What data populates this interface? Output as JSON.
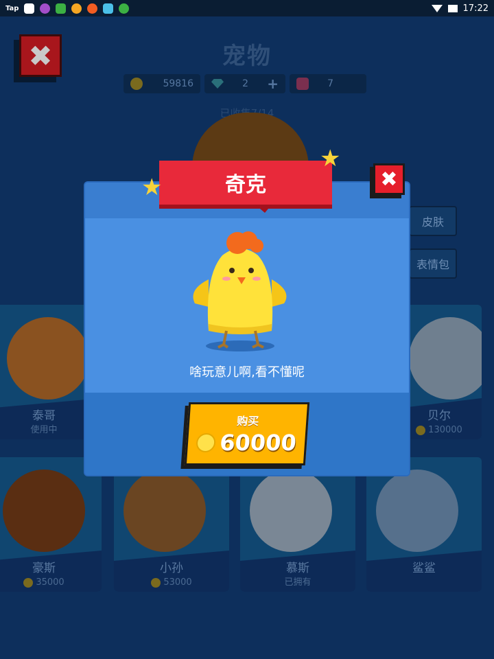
{
  "status_bar": {
    "tap_label": "Tap",
    "time": "17:22"
  },
  "background": {
    "title": "宠物",
    "currency": {
      "coins": "59816",
      "gems": "2",
      "gem_add": "+",
      "bags": "7"
    },
    "collected": "已收集7/14",
    "side_buttons": [
      "皮肤",
      "表情包"
    ],
    "cards": [
      {
        "name": "泰哥",
        "sub": "使用中",
        "coin": false,
        "color": "#c9772a"
      },
      {
        "name": "贝尔",
        "sub": "130000",
        "coin": true,
        "color": "#d8d8d8"
      },
      {
        "name": "豪斯",
        "sub": "35000",
        "coin": true,
        "color": "#8a4a1e"
      },
      {
        "name": "小孙",
        "sub": "53000",
        "coin": true,
        "color": "#9a6a3a"
      },
      {
        "name": "慕斯",
        "sub": "已拥有",
        "coin": false,
        "color": "#cfd6df"
      },
      {
        "name": "鲨鲨",
        "sub": "",
        "coin": false,
        "color": "#8ea6bf"
      }
    ]
  },
  "modal": {
    "pet_name": "奇克",
    "close_icon": "close-icon",
    "description": "啥玩意儿啊,看不懂呢",
    "buy_label": "购买",
    "price": "60000",
    "colors": {
      "ribbon": "#e8293a",
      "panel": "#4a90e2",
      "buy_button": "#ffb400"
    }
  }
}
